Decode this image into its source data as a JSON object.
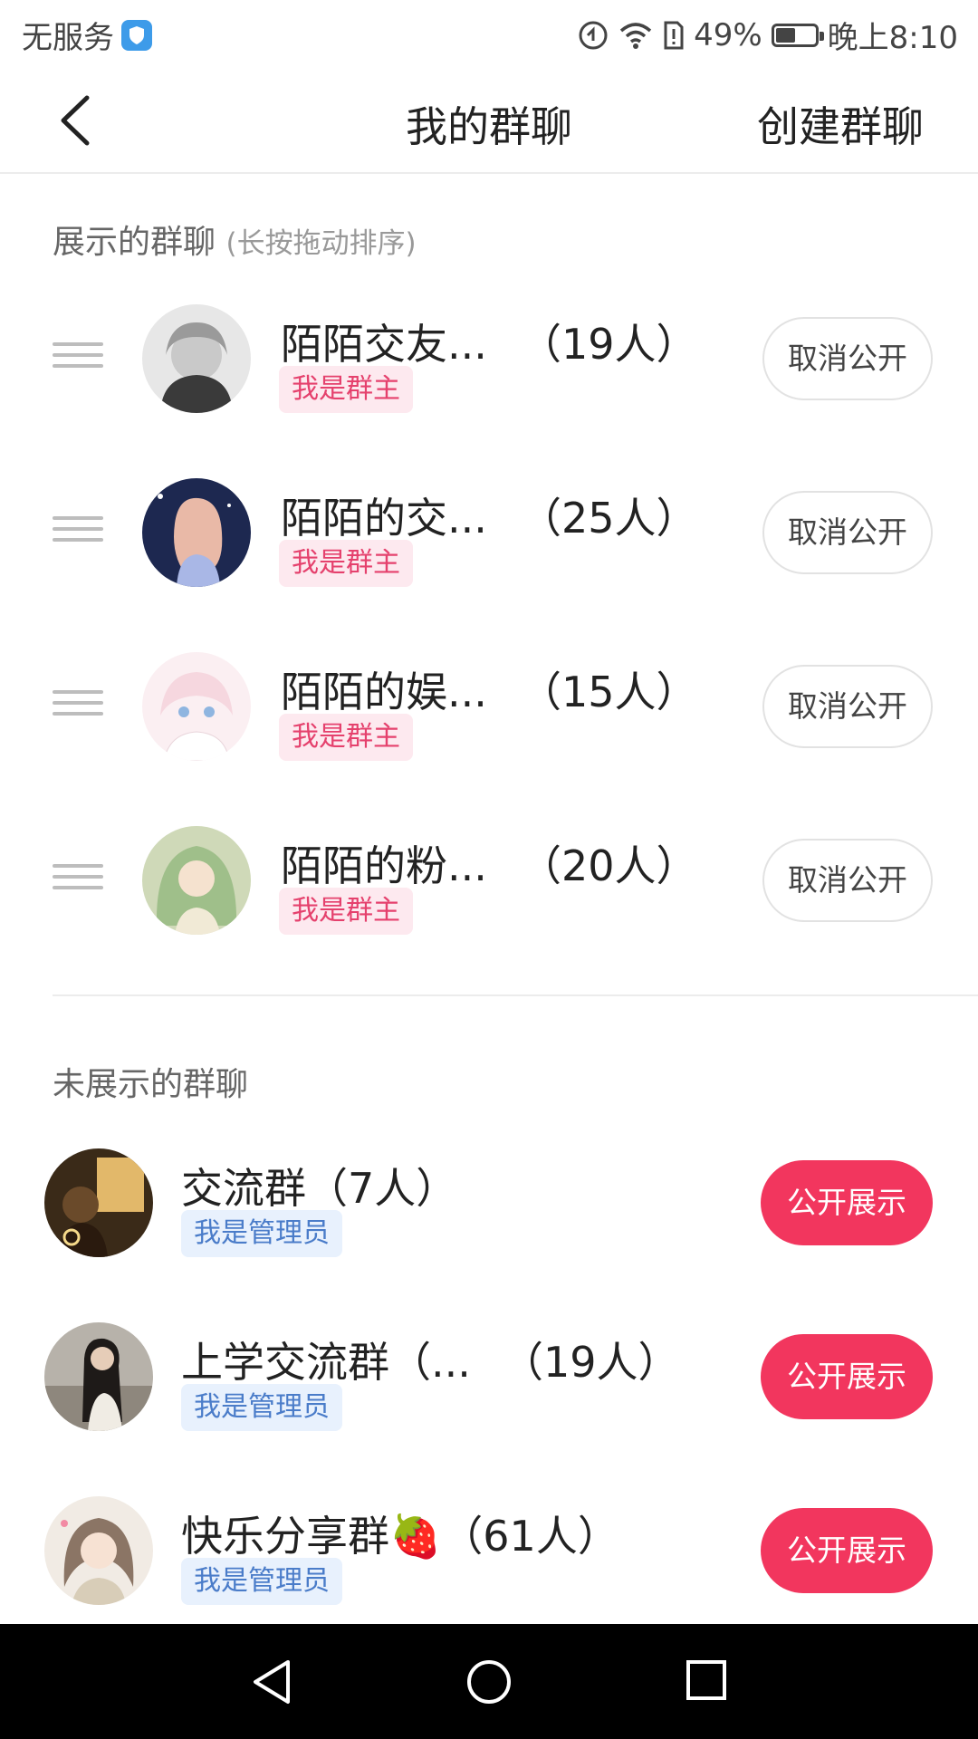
{
  "status_bar": {
    "carrier": "无服务",
    "battery": "49%",
    "battery_level": 0.49,
    "time": "晚上8:10"
  },
  "header": {
    "title": "我的群聊",
    "action": "创建群聊"
  },
  "shown_section": {
    "title": "展示的群聊",
    "hint": "(长按拖动排序)",
    "groups": [
      {
        "name": "陌陌交友...",
        "count": "（19人）",
        "role": "我是群主",
        "button": "取消公开"
      },
      {
        "name": "陌陌的交...",
        "count": "（25人）",
        "role": "我是群主",
        "button": "取消公开"
      },
      {
        "name": "陌陌的娱...",
        "count": "（15人）",
        "role": "我是群主",
        "button": "取消公开"
      },
      {
        "name": "陌陌的粉...",
        "count": "（20人）",
        "role": "我是群主",
        "button": "取消公开"
      }
    ]
  },
  "hidden_section": {
    "title": "未展示的群聊",
    "groups": [
      {
        "name": "交流群",
        "count": "（7人）",
        "role": "我是管理员",
        "button": "公开展示"
      },
      {
        "name": "上学交流群（...",
        "count": "（19人）",
        "role": "我是管理员",
        "button": "公开展示"
      },
      {
        "name": "快乐分享群🍓",
        "count": "（61人）",
        "role": "我是管理员",
        "button": "公开展示"
      }
    ]
  },
  "colors": {
    "accent": "#f2365e",
    "owner_badge_text": "#e5416d",
    "admin_badge_text": "#4a7cc9"
  }
}
